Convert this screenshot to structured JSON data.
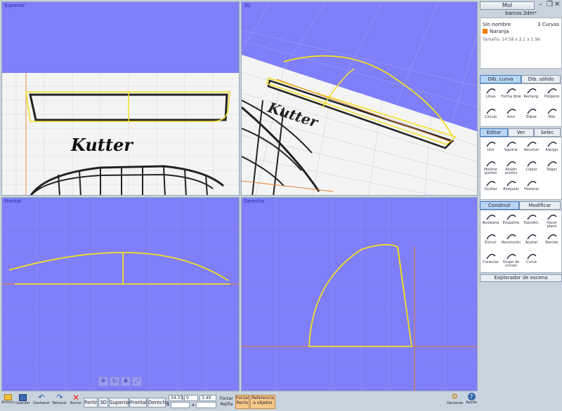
{
  "viewports": {
    "top": "Superior",
    "persp": "3D",
    "front": "Frontal",
    "right": "Derecha"
  },
  "sketch_text": "Kutter",
  "titlebar": {
    "app": "MoI",
    "file": "barcos.3dm*"
  },
  "scene": {
    "name": "Sin nombre",
    "curves": "3 Curvas",
    "layer": "Naranja",
    "layer_color": "#f08010",
    "size": "Tamaño: 14.58 x 2.1 x 1.96"
  },
  "draw_tabs": [
    "Dib. curva",
    "Dib. sólido"
  ],
  "draw_tools": [
    [
      "line-icon",
      "Línea"
    ],
    [
      "freeform-icon",
      "Forma libre"
    ],
    [
      "rectangle-icon",
      "Rectang."
    ],
    [
      "polygon-icon",
      "Polígono"
    ],
    [
      "circle-icon",
      "Círculo"
    ],
    [
      "arc-icon",
      "Arco"
    ],
    [
      "ellipse-icon",
      "Elipse"
    ],
    [
      "more-icon",
      "Más"
    ]
  ],
  "edit_tabs": [
    "Editar",
    "Ver",
    "Selec"
  ],
  "edit_tools": [
    [
      "join-icon",
      "Unir"
    ],
    [
      "separate-icon",
      "Separar"
    ],
    [
      "trim-icon",
      "Recortar"
    ],
    [
      "extend-icon",
      "Alargar"
    ],
    [
      "show-points-icon",
      "Mostrar puntos"
    ],
    [
      "add-points-icon",
      "Añadir puntos"
    ],
    [
      "copy-icon",
      "Copiar"
    ],
    [
      "paste-icon",
      "Pegar"
    ],
    [
      "hide-icon",
      "Ocultar"
    ],
    [
      "lock-icon",
      "Bloquear"
    ],
    [
      "history-icon",
      "Historial"
    ]
  ],
  "construct_tabs": [
    "Construir",
    "Modificar"
  ],
  "construct_tools": [
    [
      "boolean-icon",
      "Booleana"
    ],
    [
      "fillet-icon",
      "Empalme"
    ],
    [
      "offset-icon",
      "Equidist."
    ],
    [
      "planar-icon",
      "Hacer plano"
    ],
    [
      "extrude-icon",
      "Extruir"
    ],
    [
      "revolve-icon",
      "Revolución"
    ],
    [
      "loft-icon",
      "Ajustar"
    ],
    [
      "sweep-icon",
      "Barrido"
    ],
    [
      "network-icon",
      "Conectar"
    ],
    [
      "curve-group-icon",
      "Grupo de curvas"
    ],
    [
      "curve-icon",
      "Curva"
    ]
  ],
  "scene_browser": "Explorador de escena",
  "nav_labels": [
    "Mover",
    "Rotar",
    "Zoom",
    "Restaurar"
  ],
  "bottom": {
    "open": "Archivo",
    "save": "Guardar",
    "undo": "Deshacer",
    "redo": "Rehacer",
    "delete": "Borrar",
    "views": [
      "Partir",
      "3D",
      "Superior",
      "Frontal",
      "Derecha"
    ],
    "coord_x": "34.33",
    "coord_y": "0",
    "coord_z": "3.49",
    "coord_d": "d",
    "coord_a": "a",
    "snap1": "Forzar",
    "snap2": "Rejilla",
    "ortho1": "Forzar",
    "ortho2": "Recto",
    "ref1": "Referencia",
    "ref2": "a objetos",
    "options": "Opciones",
    "help": "Ayuda"
  }
}
